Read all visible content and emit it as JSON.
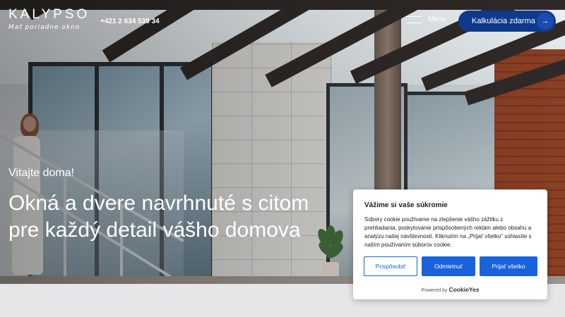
{
  "brand": {
    "name": "KALYPSO",
    "tagline": "Mať poriadne okno"
  },
  "header": {
    "phone": "+421 2 634 539 34",
    "menu_label": "Menu",
    "cta_label": "Kalkulácia zdarma",
    "cta_icon": "arrow-right-icon"
  },
  "hero": {
    "welcome": "Vitajte doma!",
    "headline": "Okná a dvere navrhnuté s citom pre každý detail vášho domova"
  },
  "cookie": {
    "title": "Vážime si vaše súkromie",
    "text": "Súbory cookie používame na zlepšenie vášho zážitku z prehliadania, poskytovanie prispôsobených reklám alebo obsahu a analýzu našej návštevnosti. Kliknutím na „Prijať všetko“ súhlasíte s naším používaním súborov cookie.",
    "customize_label": "Prispôsobiť",
    "reject_label": "Odmietnuť",
    "accept_label": "Prijať všetko",
    "powered_by": "Powered by",
    "powered_brand": "CookieYes"
  },
  "colors": {
    "brand_blue": "#0f3a8c",
    "cookie_blue": "#1863dc"
  }
}
